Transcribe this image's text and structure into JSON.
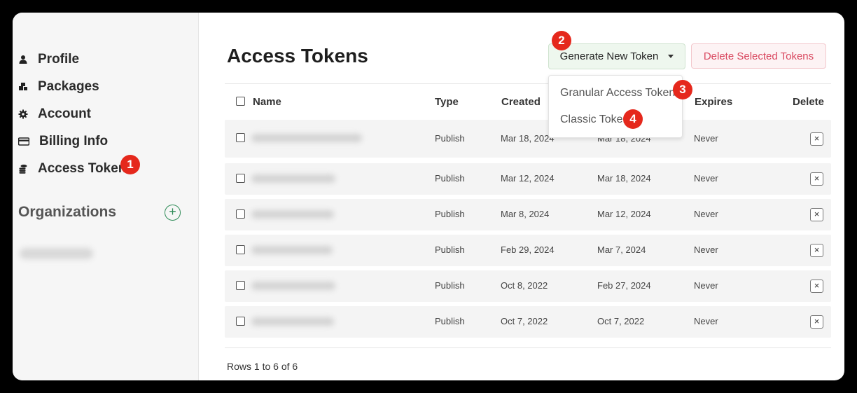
{
  "sidebar": {
    "items": [
      {
        "label": "Profile",
        "icon": "user-icon"
      },
      {
        "label": "Packages",
        "icon": "packages-icon"
      },
      {
        "label": "Account",
        "icon": "gear-icon"
      },
      {
        "label": "Billing Info",
        "icon": "credit-card-icon"
      },
      {
        "label": "Access Tokens",
        "icon": "coins-icon"
      }
    ],
    "organizations_heading": "Organizations",
    "add_org_symbol": "+"
  },
  "main": {
    "title": "Access Tokens",
    "generate_button": "Generate New Token",
    "delete_selected_button": "Delete Selected Tokens",
    "dropdown": {
      "items": [
        "Granular Access Token",
        "Classic Token"
      ]
    },
    "table": {
      "headers": [
        "Name",
        "Type",
        "Created",
        "Expires",
        "Delete"
      ],
      "rows": [
        {
          "type": "Publish",
          "created": "Mar 18, 2024",
          "last_used": "Mar 18, 2024",
          "expires": "Never"
        },
        {
          "type": "Publish",
          "created": "Mar 12, 2024",
          "last_used": "Mar 18, 2024",
          "expires": "Never"
        },
        {
          "type": "Publish",
          "created": "Mar 8, 2024",
          "last_used": "Mar 12, 2024",
          "expires": "Never"
        },
        {
          "type": "Publish",
          "created": "Feb 29, 2024",
          "last_used": "Mar 7, 2024",
          "expires": "Never"
        },
        {
          "type": "Publish",
          "created": "Oct 8, 2022",
          "last_used": "Feb 27, 2024",
          "expires": "Never"
        },
        {
          "type": "Publish",
          "created": "Oct 7, 2022",
          "last_used": "Oct 7, 2022",
          "expires": "Never"
        }
      ],
      "delete_symbol": "×"
    },
    "rows_count": "Rows 1 to 6 of 6"
  },
  "badges": [
    "1",
    "2",
    "3",
    "4"
  ],
  "colors": {
    "badge": "#e5281c",
    "generate_button_bg": "#eef7ee",
    "delete_button_text": "#d9485f",
    "org_add": "#2e8b57"
  }
}
